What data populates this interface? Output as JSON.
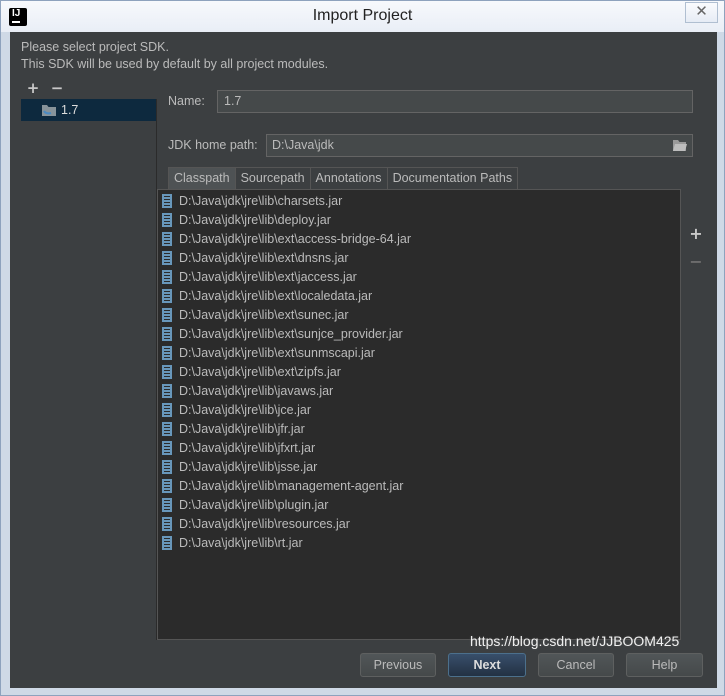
{
  "window": {
    "title": "Import Project",
    "close_glyph": "✕"
  },
  "intro": {
    "line1": "Please select project SDK.",
    "line2": "This SDK will be used by default by all project modules."
  },
  "sdk_toolbar": {
    "add": "+",
    "remove": "−"
  },
  "sdk_list": [
    {
      "label": "1.7",
      "icon": "folder-icon"
    }
  ],
  "form": {
    "name_label": "Name:",
    "name_value": "1.7",
    "jdk_label": "JDK home path:",
    "jdk_value": "D:\\Java\\jdk"
  },
  "tabs": [
    {
      "label": "Classpath",
      "active": true
    },
    {
      "label": "Sourcepath",
      "active": false
    },
    {
      "label": "Annotations",
      "active": false
    },
    {
      "label": "Documentation Paths",
      "active": false
    }
  ],
  "classpath": [
    "D:\\Java\\jdk\\jre\\lib\\charsets.jar",
    "D:\\Java\\jdk\\jre\\lib\\deploy.jar",
    "D:\\Java\\jdk\\jre\\lib\\ext\\access-bridge-64.jar",
    "D:\\Java\\jdk\\jre\\lib\\ext\\dnsns.jar",
    "D:\\Java\\jdk\\jre\\lib\\ext\\jaccess.jar",
    "D:\\Java\\jdk\\jre\\lib\\ext\\localedata.jar",
    "D:\\Java\\jdk\\jre\\lib\\ext\\sunec.jar",
    "D:\\Java\\jdk\\jre\\lib\\ext\\sunjce_provider.jar",
    "D:\\Java\\jdk\\jre\\lib\\ext\\sunmscapi.jar",
    "D:\\Java\\jdk\\jre\\lib\\ext\\zipfs.jar",
    "D:\\Java\\jdk\\jre\\lib\\javaws.jar",
    "D:\\Java\\jdk\\jre\\lib\\jce.jar",
    "D:\\Java\\jdk\\jre\\lib\\jfr.jar",
    "D:\\Java\\jdk\\jre\\lib\\jfxrt.jar",
    "D:\\Java\\jdk\\jre\\lib\\jsse.jar",
    "D:\\Java\\jdk\\jre\\lib\\management-agent.jar",
    "D:\\Java\\jdk\\jre\\lib\\plugin.jar",
    "D:\\Java\\jdk\\jre\\lib\\resources.jar",
    "D:\\Java\\jdk\\jre\\lib\\rt.jar"
  ],
  "side_tools": {
    "add": "+",
    "remove": "−"
  },
  "buttons": {
    "previous": "Previous",
    "next": "Next",
    "cancel": "Cancel",
    "help": "Help"
  },
  "watermark": "https://blog.csdn.net/JJBOOM425",
  "colors": {
    "background": "#3c3f41",
    "list_background": "#2b2b2b",
    "selection": "#0d293e",
    "jar_icon": "#6897bb"
  }
}
